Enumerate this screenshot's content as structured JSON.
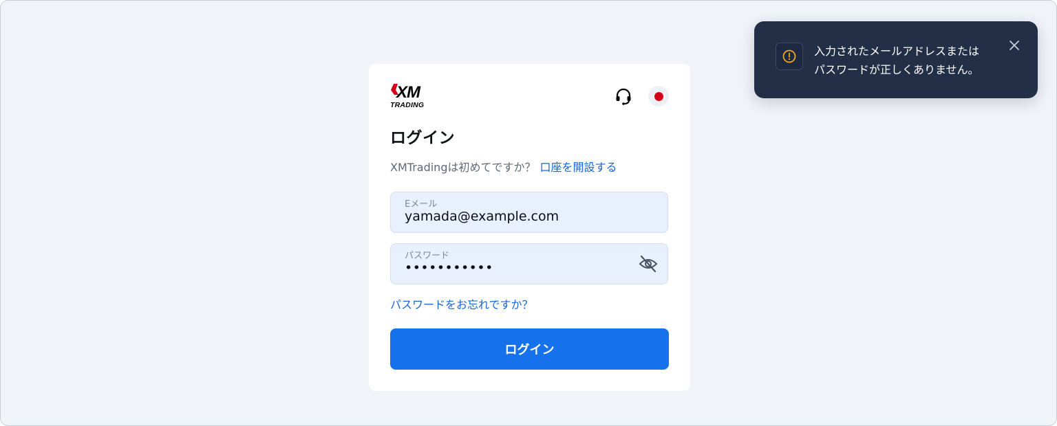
{
  "brand": {
    "logo_mark": "XM",
    "logo_text": "TRADING"
  },
  "login_card": {
    "title": "ログイン",
    "signup_prompt": "XMTradingは初めてですか？",
    "signup_link": "口座を開設する",
    "email": {
      "label": "Eメール",
      "value": "yamada@example.com"
    },
    "password": {
      "label": "パスワード",
      "value": "•••••••••••"
    },
    "forgot_link": "パスワードをお忘れですか？",
    "submit_label": "ログイン"
  },
  "toast": {
    "message": "入力されたメールアドレスまたは\nパスワードが正しくありません。"
  },
  "icons": {
    "support": "headset-icon",
    "language": "japan-flag-icon",
    "password_toggle": "eye-off-icon",
    "toast_warning": "warning-circle-icon",
    "toast_close": "close-icon"
  },
  "colors": {
    "accent": "#1672ec",
    "link": "#1565d8",
    "toast_bg": "#222f47",
    "warning": "#f5a623",
    "flag_red": "#d7001a"
  }
}
